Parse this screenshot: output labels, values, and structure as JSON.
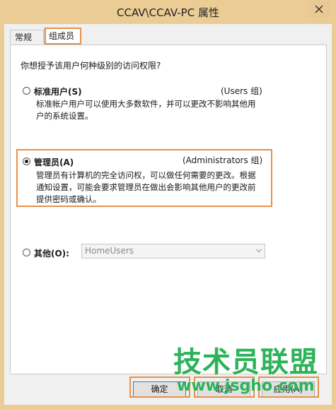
{
  "window": {
    "title": "CCAV\\CCAV-PC 属性"
  },
  "tabs": [
    {
      "label": "常规",
      "active": false
    },
    {
      "label": "组成员",
      "active": true
    }
  ],
  "question": "你想授予该用户何种级别的访问权限?",
  "options": {
    "standard": {
      "label": "标准用户(S)",
      "group": "(Users 组)",
      "desc_line1": "标准帐户用户可以使用大多数软件，并可以更改不影响其他用",
      "desc_line2": "户的系统设置。",
      "selected": false
    },
    "admin": {
      "label": "管理员(A)",
      "group": "(Administrators 组)",
      "desc_line1": "管理员有计算机的完全访问权，可以做任何需要的更改。根据",
      "desc_line2": "通知设置，可能会要求管理员在做出会影响其他用户的更改前",
      "desc_line3": "提供密码或确认。",
      "selected": true
    },
    "other": {
      "label": "其他(O):",
      "select_value": "HomeUsers",
      "selected": false
    }
  },
  "buttons": {
    "ok": "确定",
    "cancel": "取消",
    "apply": "应用(A)"
  },
  "watermark": {
    "text": "技术员联盟",
    "url": "www.jsgho.com"
  },
  "colors": {
    "frame": "#ebcc95",
    "highlight": "#e8914a",
    "watermark": "#2db35a"
  }
}
